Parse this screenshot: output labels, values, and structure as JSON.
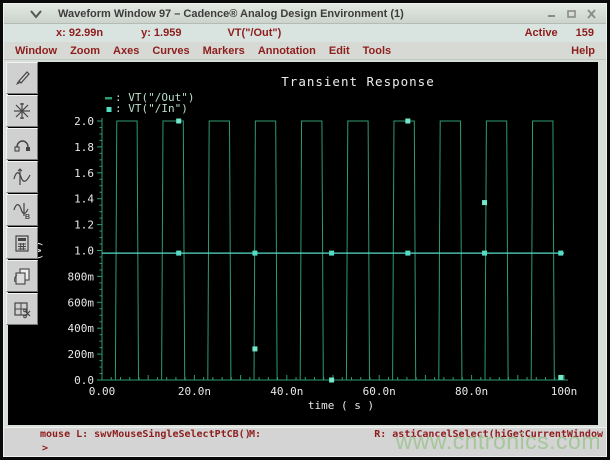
{
  "window": {
    "title": "Waveform Window 97 – Cadence® Analog Design Environment (1)",
    "menu_icon": "chevron-down",
    "controls": [
      "minimize",
      "maximize",
      "close"
    ]
  },
  "status_row": {
    "x": "x: 92.99n",
    "y": "y: 1.959",
    "trace": "VT(\"/Out\")",
    "active_label": "Active",
    "active_count": "159"
  },
  "menu_bar": {
    "items": [
      "Window",
      "Zoom",
      "Axes",
      "Curves",
      "Markers",
      "Annotation",
      "Edit",
      "Tools"
    ],
    "help": "Help"
  },
  "toolbar": {
    "buttons": [
      "brush",
      "starburst",
      "arc-probe",
      "waveform-marker-a",
      "waveform-marker-b",
      "calculator",
      "copy-document",
      "subwindow-cut"
    ]
  },
  "plot": {
    "title": "Transient Response",
    "ylabel": "(V)",
    "xlabel": "time ( s )"
  },
  "chart_data": {
    "type": "line",
    "title": "Transient Response",
    "xlabel": "time ( s )",
    "ylabel": "(V)",
    "xlim_ns": [
      0,
      100
    ],
    "ylim": [
      0,
      2.0
    ],
    "grid": false,
    "legend_position": "top-left",
    "x_ticks": [
      {
        "t": 0,
        "label": "0.00"
      },
      {
        "t": 20,
        "label": "20.0n"
      },
      {
        "t": 40,
        "label": "40.0n"
      },
      {
        "t": 60,
        "label": "60.0n"
      },
      {
        "t": 80,
        "label": "80.0n"
      },
      {
        "t": 100,
        "label": "100n"
      }
    ],
    "x_minor_step_ns": 2,
    "y_ticks": [
      {
        "v": 0.0,
        "label": "0.0"
      },
      {
        "v": 0.2,
        "label": "200m"
      },
      {
        "v": 0.4,
        "label": "400m"
      },
      {
        "v": 0.6,
        "label": "600m"
      },
      {
        "v": 0.8,
        "label": "800m"
      },
      {
        "v": 1.0,
        "label": "1.0"
      },
      {
        "v": 1.2,
        "label": "1.2"
      },
      {
        "v": 1.4,
        "label": "1.4"
      },
      {
        "v": 1.6,
        "label": "1.6"
      },
      {
        "v": 1.8,
        "label": "1.8"
      },
      {
        "v": 2.0,
        "label": "2.0"
      }
    ],
    "y_minor_step": 0.05,
    "series": [
      {
        "name": "VT(\"/Out\")",
        "legend_marker": "dash",
        "color": "#2e9b70",
        "shape": "square-wave",
        "low": 0.0,
        "high": 2.0,
        "rise_times_ns": [
          2.9,
          12.9,
          22.9,
          32.9,
          42.9,
          52.9,
          62.9,
          72.9,
          82.9,
          92.9
        ],
        "flat_top_ns": 4.4,
        "transition_ns": 0.3,
        "marker_color": "#73e8cd",
        "markers": [
          {
            "t": 16.6,
            "v": 2.0
          },
          {
            "t": 33.1,
            "v": 0.24
          },
          {
            "t": 49.7,
            "v": 0.0
          },
          {
            "t": 66.2,
            "v": 2.0
          },
          {
            "t": 82.8,
            "v": 1.37
          },
          {
            "t": 99.3,
            "v": 0.02
          }
        ]
      },
      {
        "name": "VT(\"/In\")",
        "legend_marker": "square",
        "color": "#55dcc5",
        "shape": "constant",
        "value": 0.98,
        "marker_times_ns": [
          16.6,
          33.1,
          49.7,
          66.2,
          82.8,
          99.3
        ]
      }
    ]
  },
  "bottom_bar": {
    "mouse_l": "mouse L: swvMouseSingleSelectPtCB()",
    "mouse_m": "M:",
    "mouse_r": "R: astiCancelSelect(hiGetCurrentWindow",
    "prompt": ">"
  },
  "watermark": "www.cntronics.com",
  "colors": {
    "plot_bg": "#000000",
    "axis": "#2e9b70",
    "axis_label": "#e8e8e8",
    "legend_text": "#b9dec9",
    "plot_title": "#ededed",
    "menu_text": "#8e1d1d",
    "chrome_bg": "#d8ded8"
  }
}
